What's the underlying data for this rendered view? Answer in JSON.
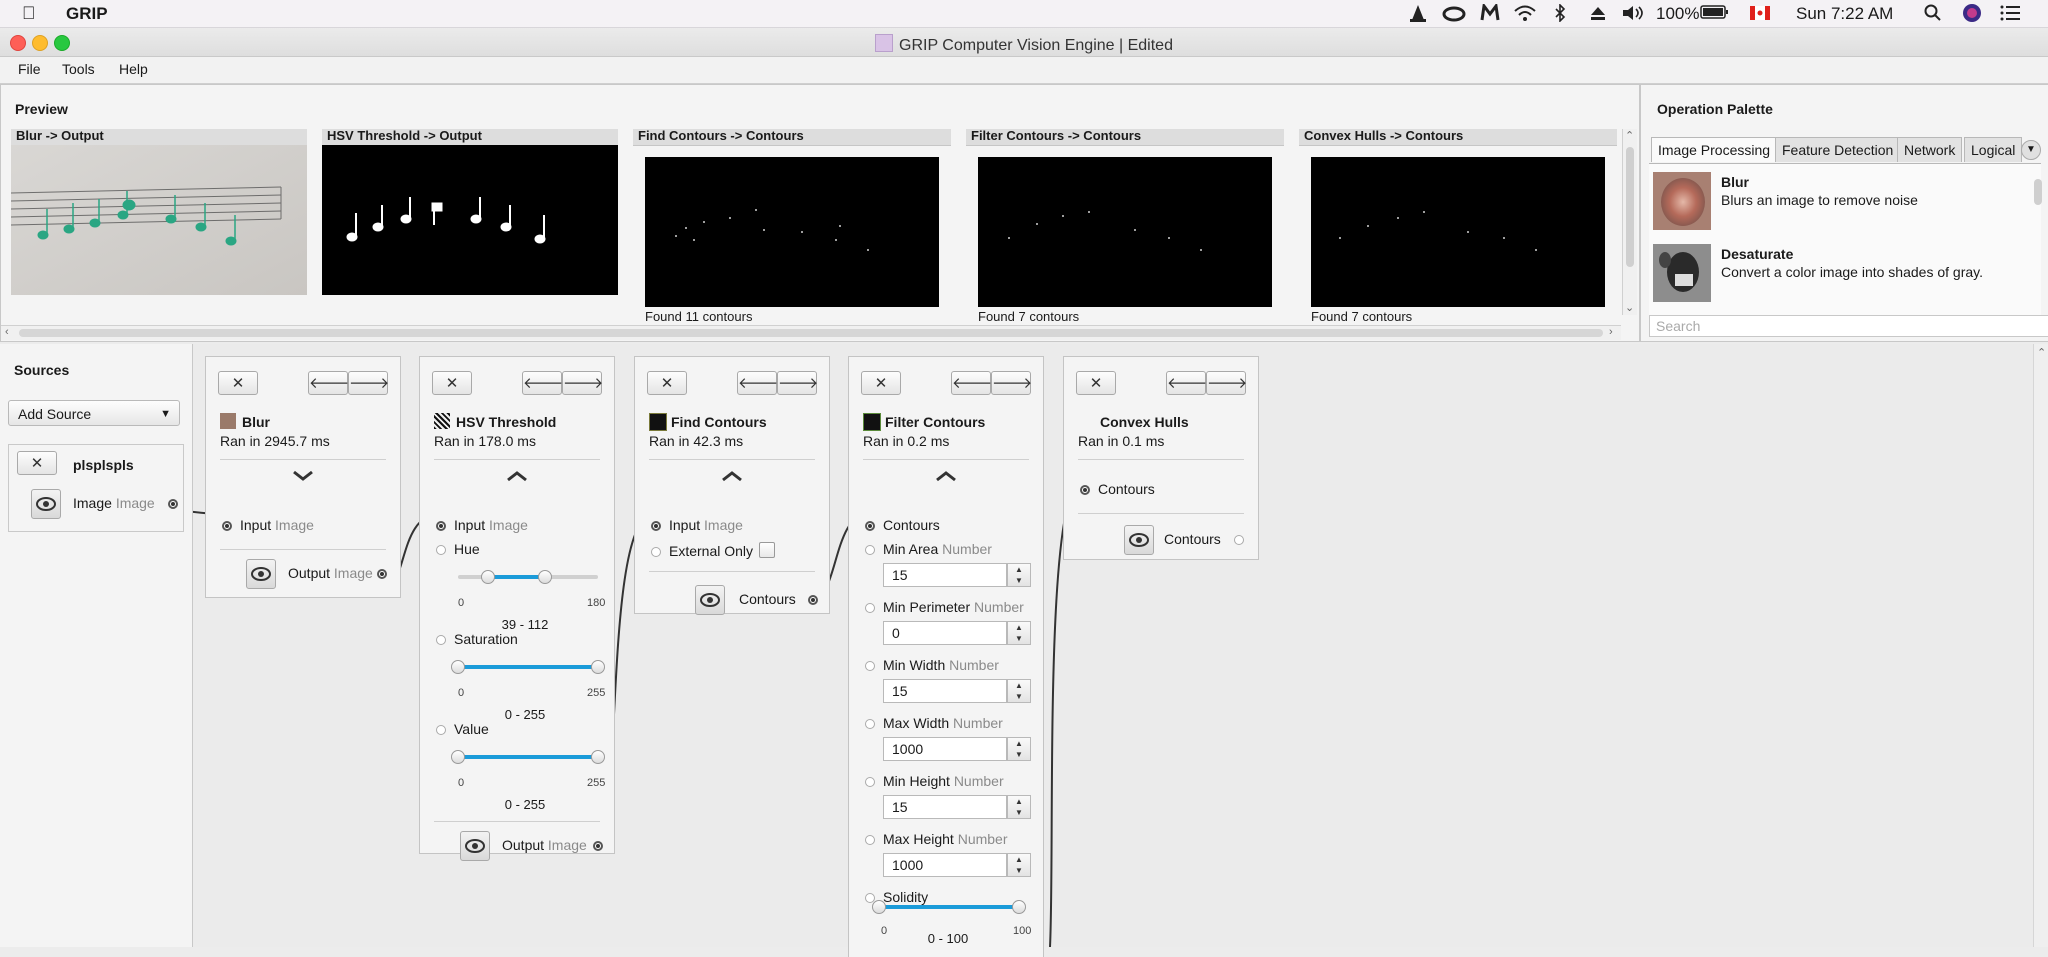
{
  "menubar": {
    "app_name": "GRIP",
    "battery_text": "100%",
    "clock": "Sun 7:22 AM",
    "icons": [
      "cone-icon",
      "creative-cloud-icon",
      "malwarebytes-icon",
      "wifi-icon",
      "bluetooth-icon",
      "eject-icon",
      "volume-icon",
      "battery-icon",
      "flag-icon",
      "search-icon",
      "siri-icon",
      "list-icon"
    ]
  },
  "window": {
    "title": "GRIP Computer Vision Engine | Edited"
  },
  "app_menu": {
    "file": "File",
    "tools": "Tools",
    "help": "Help"
  },
  "preview": {
    "title": "Preview",
    "cards": [
      {
        "header": "Blur -> Output",
        "caption": ""
      },
      {
        "header": "HSV Threshold -> Output",
        "caption": ""
      },
      {
        "header": "Find Contours -> Contours",
        "caption": "Found 11 contours"
      },
      {
        "header": "Filter Contours -> Contours",
        "caption": "Found 7 contours"
      },
      {
        "header": "Convex Hulls -> Contours",
        "caption": "Found 7 contours"
      }
    ]
  },
  "palette": {
    "title": "Operation Palette",
    "tabs": [
      "Image Processing",
      "Feature Detection",
      "Network",
      "Logical"
    ],
    "operations": [
      {
        "name": "Blur",
        "desc": "Blurs an image to remove noise"
      },
      {
        "name": "Desaturate",
        "desc": "Convert a color image into shades of gray."
      }
    ],
    "search_placeholder": "Search"
  },
  "sources": {
    "title": "Sources",
    "add_label": "Add Source",
    "source_name": "plsplspls",
    "output_label": "Image",
    "output_type": "Image"
  },
  "steps": {
    "blur": {
      "name": "Blur",
      "time": "Ran in 2945.7 ms",
      "input": "Input",
      "input_type": "Image",
      "output": "Output",
      "output_type": "Image"
    },
    "hsv": {
      "name": "HSV Threshold",
      "time": "Ran in 178.0 ms",
      "input": "Input",
      "input_type": "Image",
      "hue": {
        "label": "Hue",
        "min_tick": "0",
        "max_tick": "180",
        "range": "39 - 112",
        "low": 39,
        "high": 112,
        "max": 180
      },
      "saturation": {
        "label": "Saturation",
        "min_tick": "0",
        "max_tick": "255",
        "range": "0 - 255",
        "low": 0,
        "high": 255,
        "max": 255
      },
      "value": {
        "label": "Value",
        "min_tick": "0",
        "max_tick": "255",
        "range": "0 - 255",
        "low": 0,
        "high": 255,
        "max": 255
      },
      "output": "Output",
      "output_type": "Image"
    },
    "find": {
      "name": "Find Contours",
      "time": "Ran in 42.3 ms",
      "input": "Input",
      "input_type": "Image",
      "external_only": "External Only",
      "output": "Contours"
    },
    "filter": {
      "name": "Filter Contours",
      "time": "Ran in 0.2 ms",
      "input": "Contours",
      "params": [
        {
          "label": "Min Area",
          "type": "Number",
          "value": "15"
        },
        {
          "label": "Min Perimeter",
          "type": "Number",
          "value": "0"
        },
        {
          "label": "Min Width",
          "type": "Number",
          "value": "15"
        },
        {
          "label": "Max Width",
          "type": "Number",
          "value": "1000"
        },
        {
          "label": "Min Height",
          "type": "Number",
          "value": "15"
        },
        {
          "label": "Max Height",
          "type": "Number",
          "value": "1000"
        }
      ],
      "solidity": {
        "label": "Solidity",
        "min_tick": "0",
        "max_tick": "100",
        "range": "0 - 100",
        "low": 0,
        "high": 100,
        "max": 100
      }
    },
    "hulls": {
      "name": "Convex Hulls",
      "time": "Ran in 0.1 ms",
      "input": "Contours",
      "output": "Contours"
    }
  },
  "colors": {
    "accent": "#1b9bd9",
    "note_green": "#2aa683"
  }
}
